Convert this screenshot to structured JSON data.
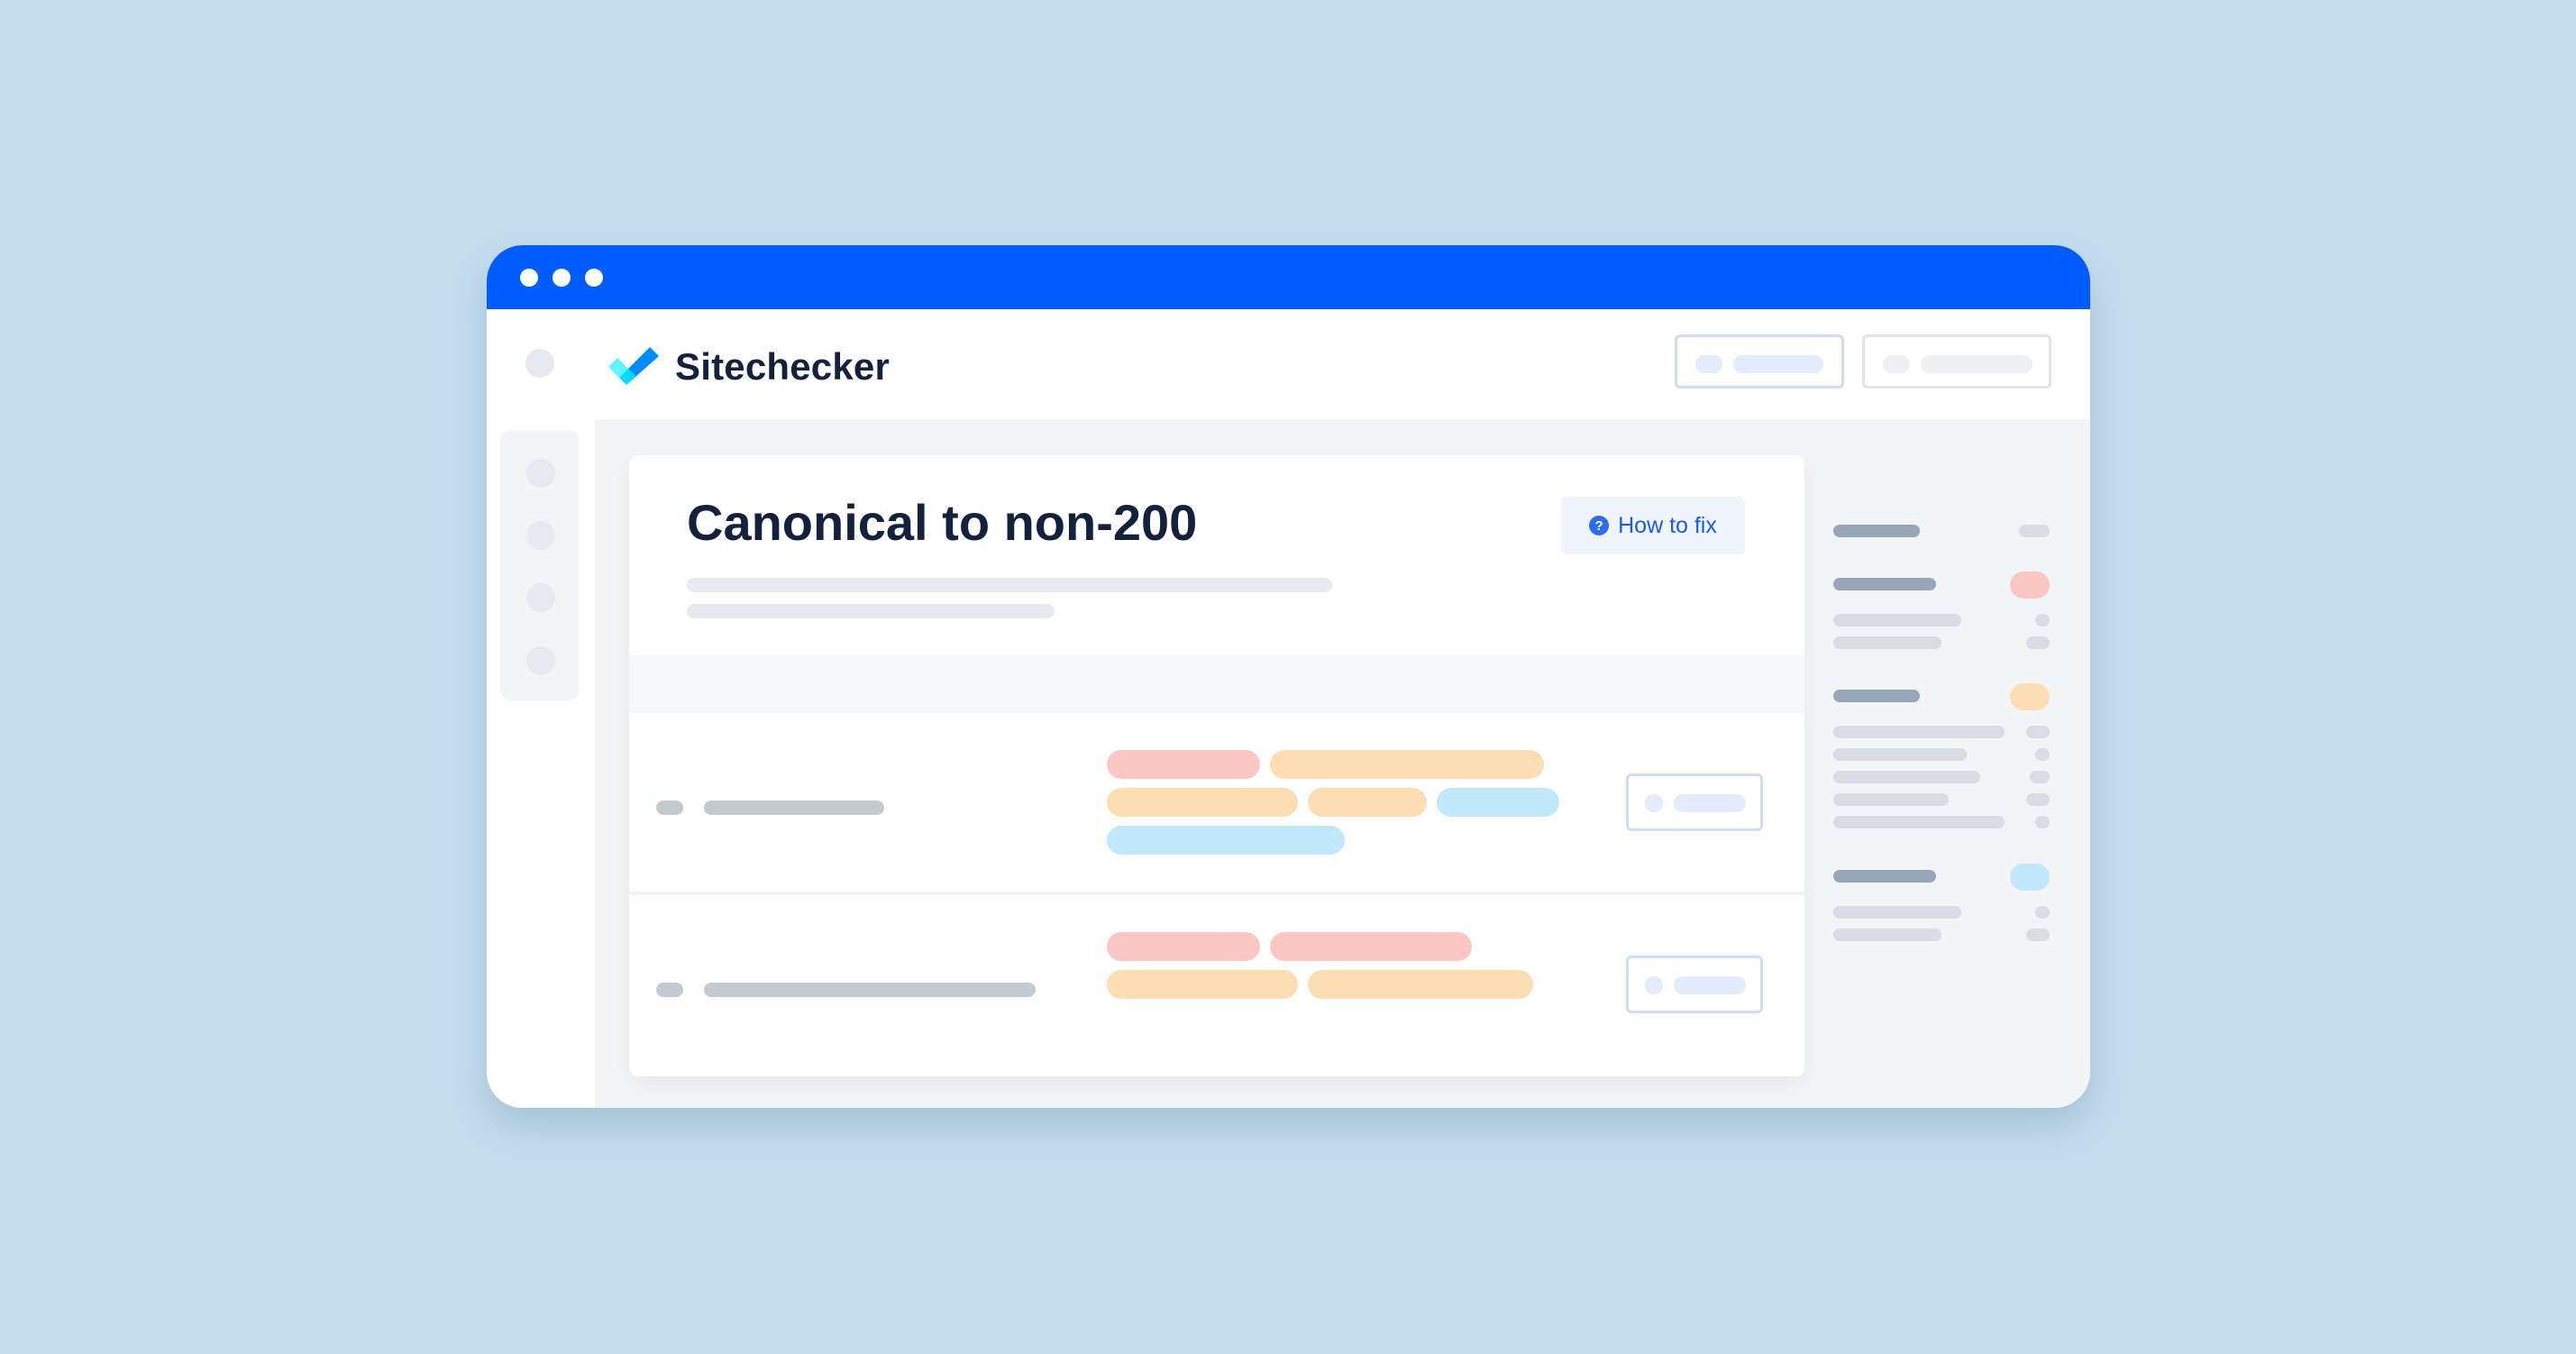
{
  "window": {
    "titlebar_color": "#005cff",
    "controls": [
      "dot",
      "dot",
      "dot"
    ]
  },
  "header": {
    "brand": "Sitechecker",
    "logo_icon": "checkmark-logo-icon",
    "buttons": [
      {
        "name": "primary-header-button",
        "style": "blue-outline"
      },
      {
        "name": "secondary-header-button",
        "style": "gray-outline"
      }
    ]
  },
  "left_sidebar": {
    "items": [
      "nav-item",
      "nav-item",
      "nav-item",
      "nav-item"
    ]
  },
  "main": {
    "title": "Canonical to non-200",
    "how_to_fix": {
      "label": "How to fix",
      "icon": "question-icon",
      "icon_glyph": "?"
    },
    "rows": [
      {
        "tags": [
          "red",
          "orange",
          "orange",
          "orange",
          "blue",
          "blue"
        ]
      },
      {
        "tags": [
          "red",
          "red",
          "orange",
          "orange"
        ]
      }
    ]
  },
  "right_panel": {
    "groups": [
      {
        "badge": "gray"
      },
      {
        "badge": "red",
        "badge_color": "#fcc6c2"
      },
      {
        "badge": "orange",
        "badge_color": "#fddeb2"
      },
      {
        "badge": "blue",
        "badge_color": "#c1e8fb"
      }
    ]
  },
  "colors": {
    "background": "#c4ddef",
    "accent": "#005cff",
    "text": "#14213d",
    "link": "#1a5ce6"
  }
}
